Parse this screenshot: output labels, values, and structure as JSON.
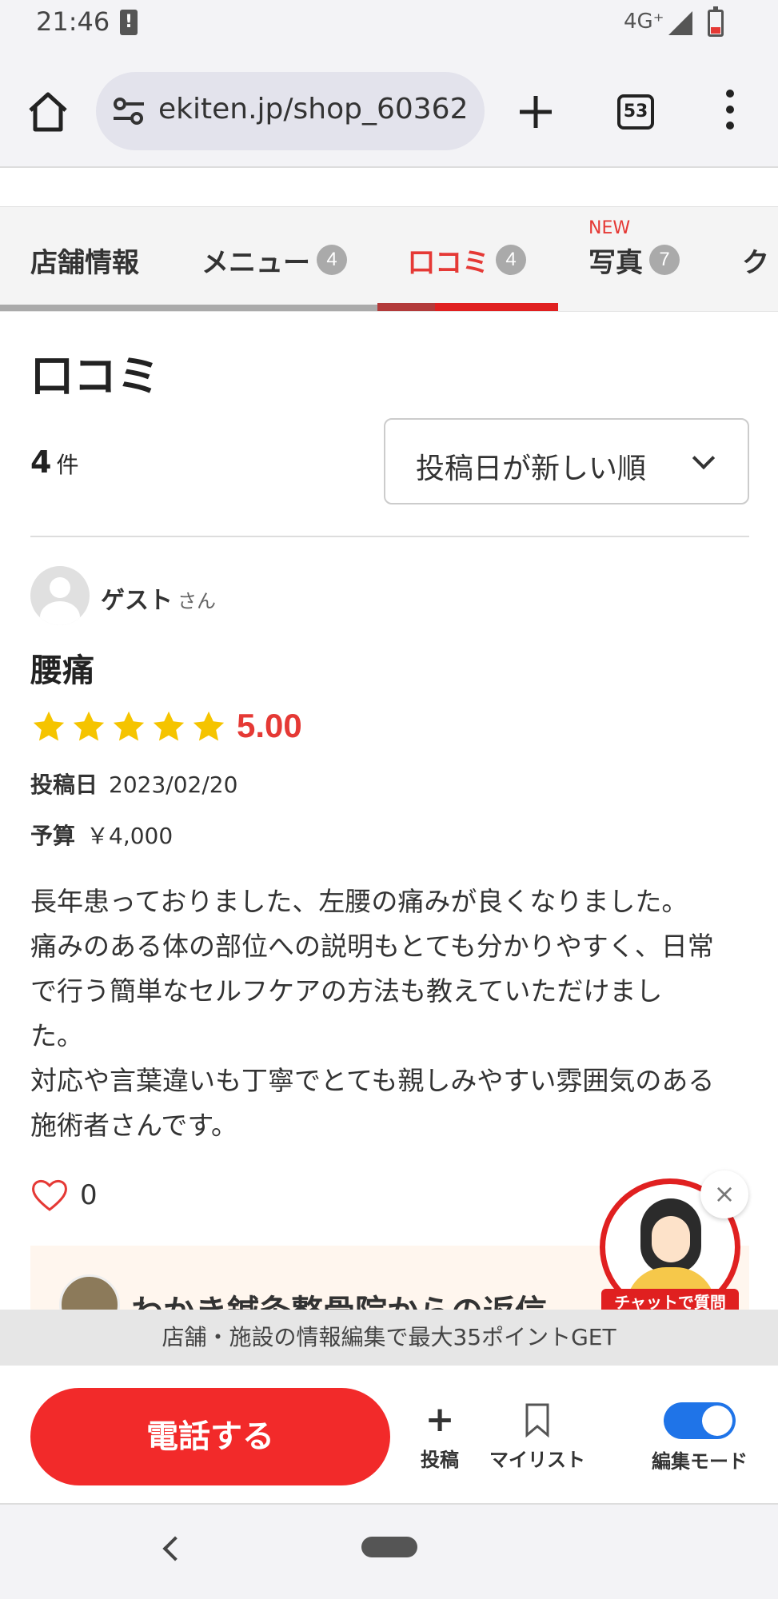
{
  "status_bar": {
    "time": "21:46",
    "network": "4G⁺"
  },
  "browser": {
    "url": "ekiten.jp/shop_60362",
    "tab_count": "53"
  },
  "tabs": [
    {
      "label": "店舗情報",
      "badge": ""
    },
    {
      "label": "メニュー",
      "badge": "4"
    },
    {
      "label": "口コミ",
      "badge": "4"
    },
    {
      "label": "写真",
      "badge": "7",
      "new_label": "NEW"
    },
    {
      "label": "ク",
      "badge": ""
    }
  ],
  "section": {
    "title": "口コミ",
    "count": "4",
    "count_unit": "件",
    "sort_label": "投稿日が新しい順"
  },
  "review": {
    "author": "ゲスト",
    "author_suffix": "さん",
    "title": "腰痛",
    "rating": "5.00",
    "stars": 5,
    "date_label": "投稿日",
    "date": "2023/02/20",
    "budget_label": "予算",
    "budget": "￥4,000",
    "body_lines": [
      "長年患っておりました、左腰の痛みが良くなりました。",
      "痛みのある体の部位への説明もとても分かりやすく、日常",
      "で行う簡単なセルフケアの方法も教えていただけまし",
      "た。",
      "対応や言葉違いも丁寧でとても親しみやすい雰囲気のある",
      "施術者さんです。"
    ],
    "likes": "0",
    "reply_title": "わかき鍼灸整骨院からの返信"
  },
  "chat": {
    "label": "チャットで質問",
    "close": "×"
  },
  "banner": {
    "text": "店舗・施設の情報編集で最大35ポイントGET"
  },
  "actions": {
    "call": "電話する",
    "post": "投稿",
    "mylist": "マイリスト",
    "edit_mode": "編集モード"
  },
  "colors": {
    "accent": "#e53935",
    "call_button": "#f22a2a",
    "toggle": "#1f74e8",
    "star": "#f5c400"
  }
}
